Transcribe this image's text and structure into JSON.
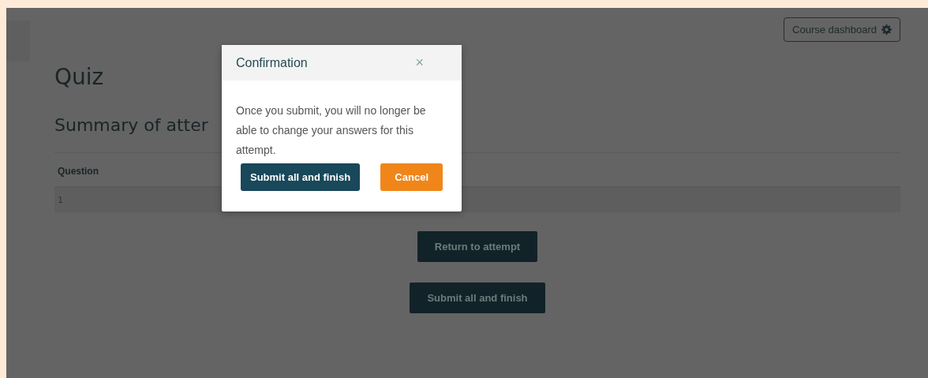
{
  "header": {
    "dashboard_button": "Course dashboard"
  },
  "page": {
    "title": "Quiz",
    "subtitle": "Summary of atter"
  },
  "table": {
    "columns": [
      "Question"
    ],
    "rows": [
      [
        "1"
      ]
    ]
  },
  "actions": [
    "Return to attempt",
    "Submit all and finish"
  ],
  "modal": {
    "title": "Confirmation",
    "close": "×",
    "message": "Once you submit, you will no longer be able to change your answers for this attempt.",
    "buttons": [
      {
        "label": "Submit all and finish",
        "kind": "primary"
      },
      {
        "label": "Cancel",
        "kind": "warning"
      }
    ]
  }
}
